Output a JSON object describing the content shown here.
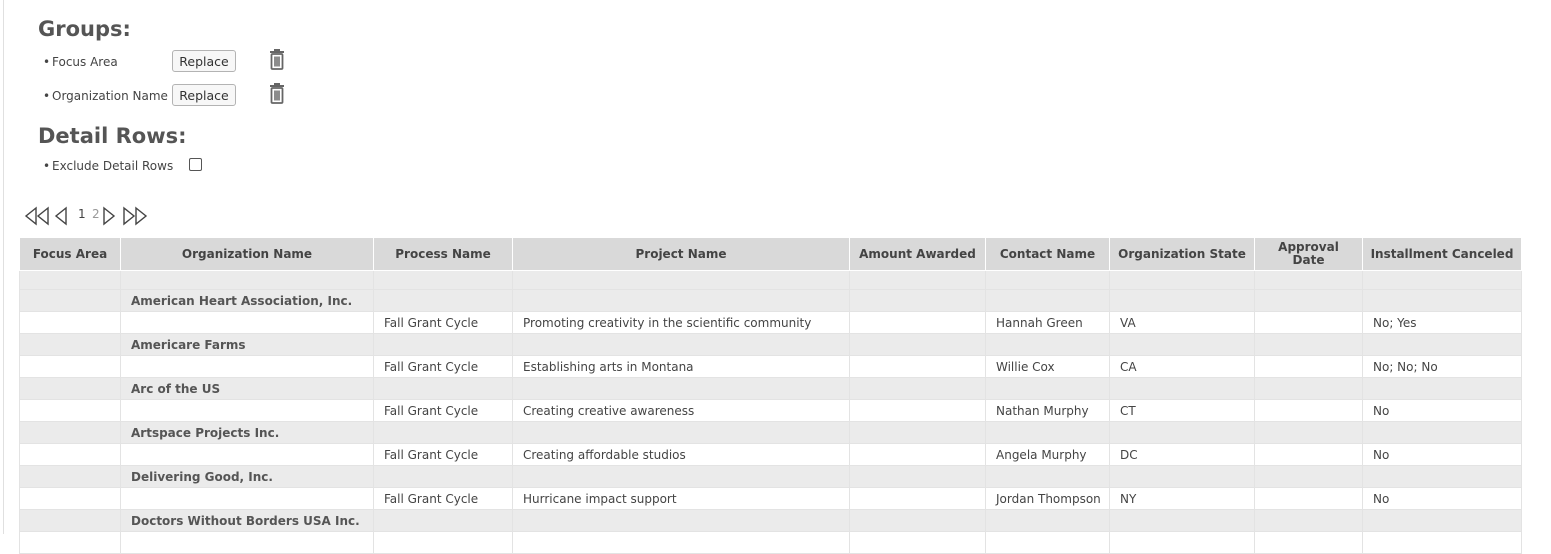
{
  "groups": {
    "title": "Groups:",
    "items": [
      {
        "label": "Focus Area",
        "button": "Replace"
      },
      {
        "label": "Organization Name",
        "button": "Replace"
      }
    ]
  },
  "detail_rows": {
    "title": "Detail Rows:",
    "exclude_label": "Exclude Detail Rows",
    "exclude_checked": false
  },
  "bullet": "•",
  "pager": {
    "pages": [
      "1",
      "2"
    ],
    "current": "1"
  },
  "table": {
    "columns": [
      "Focus Area",
      "Organization Name",
      "Process Name",
      "Project Name",
      "Amount Awarded",
      "Contact Name",
      "Organization State",
      "Approval Date",
      "Installment Canceled"
    ],
    "rows": [
      {
        "type": "spacer",
        "cells": [
          "",
          "",
          "",
          "",
          "",
          "",
          "",
          "",
          ""
        ]
      },
      {
        "type": "group",
        "cells": [
          "",
          "American Heart Association, Inc.",
          "",
          "",
          "",
          "",
          "",
          "",
          ""
        ]
      },
      {
        "type": "detail",
        "cells": [
          "",
          "",
          "Fall Grant Cycle",
          "Promoting creativity in the scientific community",
          "",
          "Hannah Green",
          "VA",
          "",
          "No; Yes"
        ]
      },
      {
        "type": "group",
        "cells": [
          "",
          "Americare Farms",
          "",
          "",
          "",
          "",
          "",
          "",
          ""
        ]
      },
      {
        "type": "detail",
        "cells": [
          "",
          "",
          "Fall Grant Cycle",
          "Establishing arts in Montana",
          "",
          "Willie Cox",
          "CA",
          "",
          "No; No; No"
        ]
      },
      {
        "type": "group",
        "cells": [
          "",
          "Arc of the US",
          "",
          "",
          "",
          "",
          "",
          "",
          ""
        ]
      },
      {
        "type": "detail",
        "cells": [
          "",
          "",
          "Fall Grant Cycle",
          "Creating creative awareness",
          "",
          "Nathan Murphy",
          "CT",
          "",
          "No"
        ]
      },
      {
        "type": "group",
        "cells": [
          "",
          "Artspace Projects Inc.",
          "",
          "",
          "",
          "",
          "",
          "",
          ""
        ]
      },
      {
        "type": "detail",
        "cells": [
          "",
          "",
          "Fall Grant Cycle",
          "Creating affordable studios",
          "",
          "Angela Murphy",
          "DC",
          "",
          "No"
        ]
      },
      {
        "type": "group",
        "cells": [
          "",
          "Delivering Good, Inc.",
          "",
          "",
          "",
          "",
          "",
          "",
          ""
        ]
      },
      {
        "type": "detail",
        "cells": [
          "",
          "",
          "Fall Grant Cycle",
          "Hurricane impact support",
          "",
          "Jordan Thompson",
          "NY",
          "",
          "No"
        ]
      },
      {
        "type": "group",
        "cells": [
          "",
          "Doctors Without Borders USA Inc.",
          "",
          "",
          "",
          "",
          "",
          "",
          ""
        ]
      },
      {
        "type": "detail",
        "cells": [
          "",
          "",
          "",
          "",
          "",
          "",
          "",
          "",
          ""
        ]
      }
    ]
  }
}
